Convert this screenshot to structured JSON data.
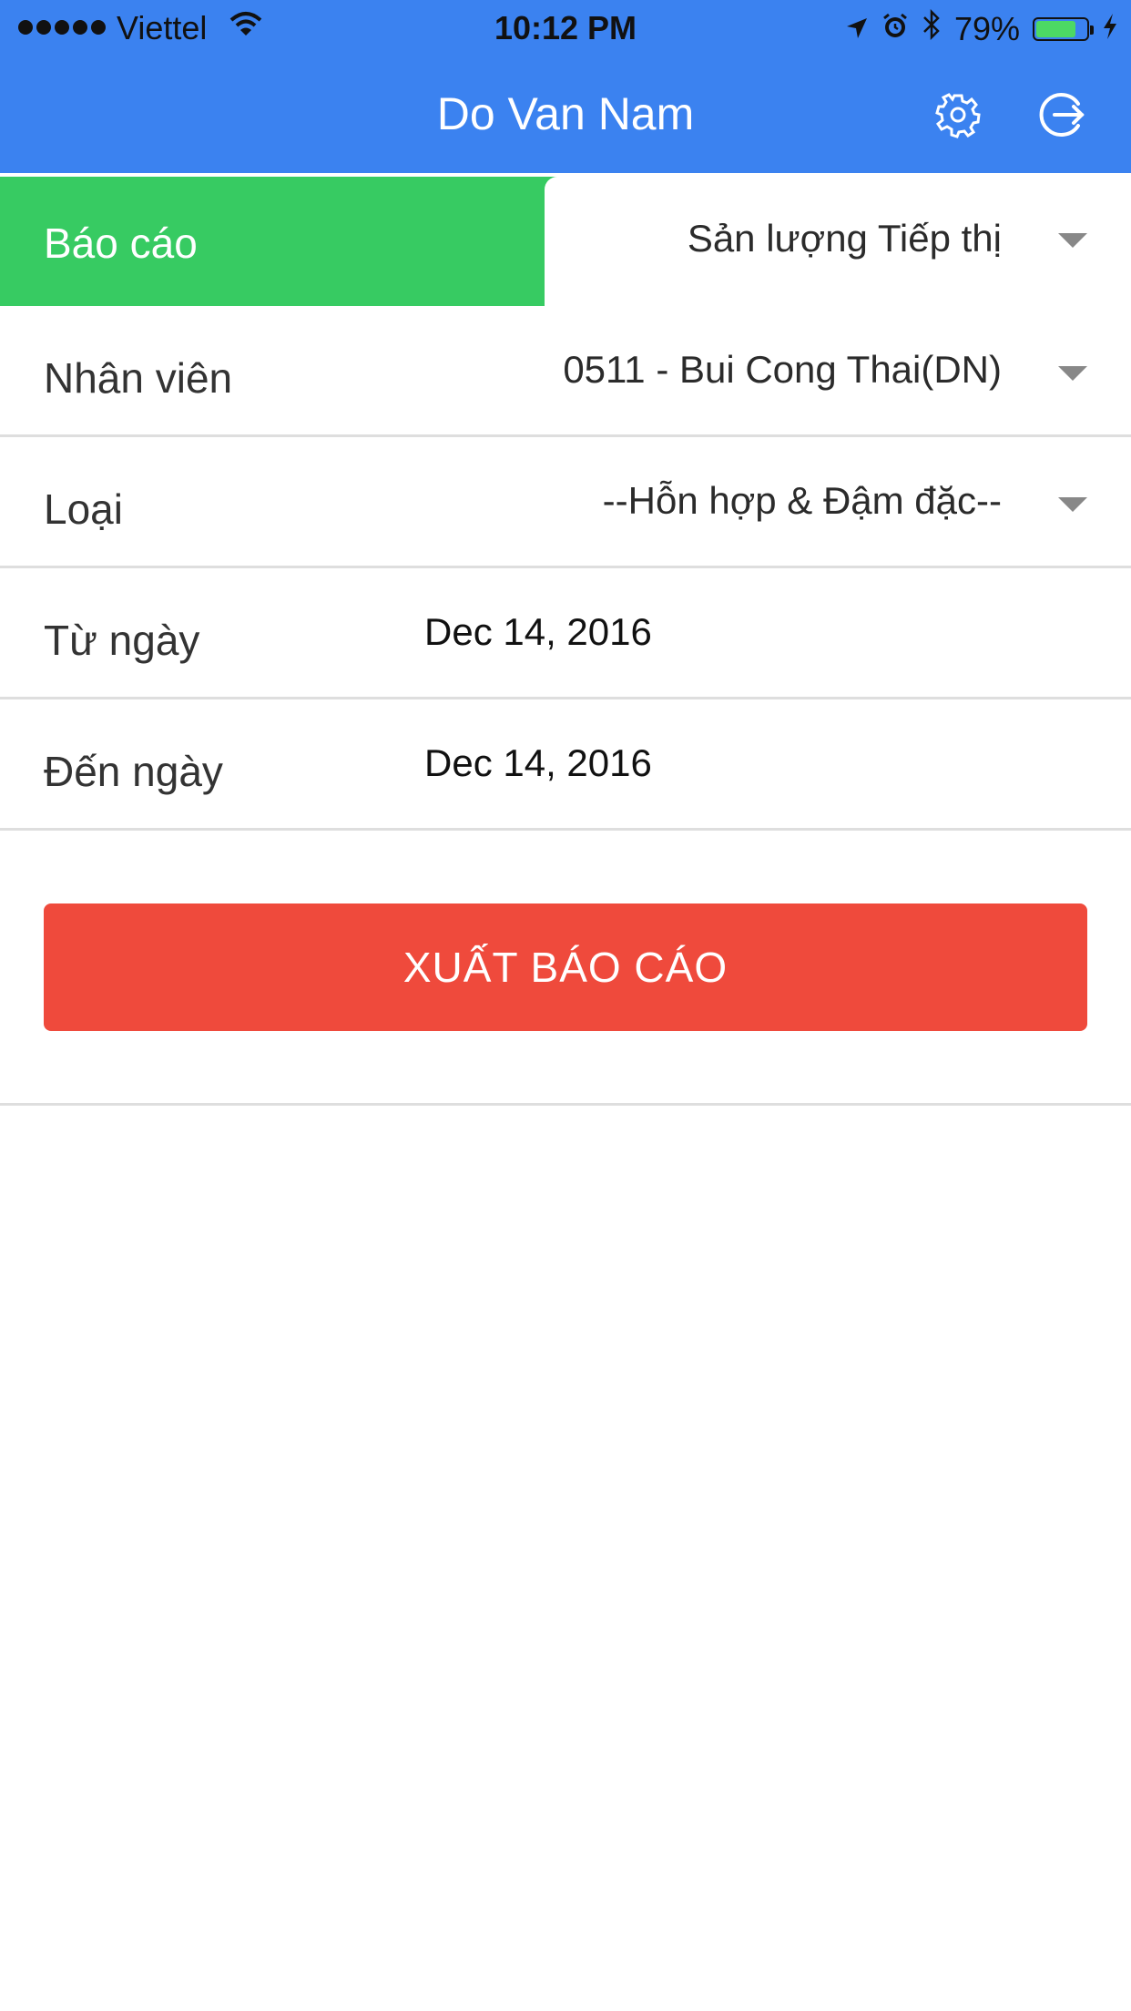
{
  "status_bar": {
    "carrier": "Viettel",
    "time": "10:12 PM",
    "battery_percent": "79%",
    "battery_level": 0.79,
    "icons": [
      "signal-icon",
      "wifi-icon",
      "location-arrow-icon",
      "alarm-icon",
      "bluetooth-icon",
      "battery-icon",
      "charging-icon"
    ]
  },
  "nav": {
    "title": "Do Van Nam",
    "icons": [
      "gear-icon",
      "logout-icon"
    ]
  },
  "report": {
    "label": "Báo cáo",
    "selected": "Sản lượng Tiếp thị"
  },
  "form": {
    "employee": {
      "label": "Nhân viên",
      "value": "0511 - Bui Cong Thai(DN)"
    },
    "type": {
      "label": "Loại",
      "value": "--Hỗn hợp & Đậm đặc--"
    },
    "from_date": {
      "label": "Từ ngày",
      "value": "Dec 14, 2016"
    },
    "to_date": {
      "label": "Đến ngày",
      "value": "Dec 14, 2016"
    }
  },
  "actions": {
    "export_label": "XUẤT BÁO CÁO"
  },
  "colors": {
    "nav_blue": "#3b82f0",
    "report_green": "#37cb62",
    "export_red": "#ef4a3c",
    "battery_green": "#4cd964"
  }
}
